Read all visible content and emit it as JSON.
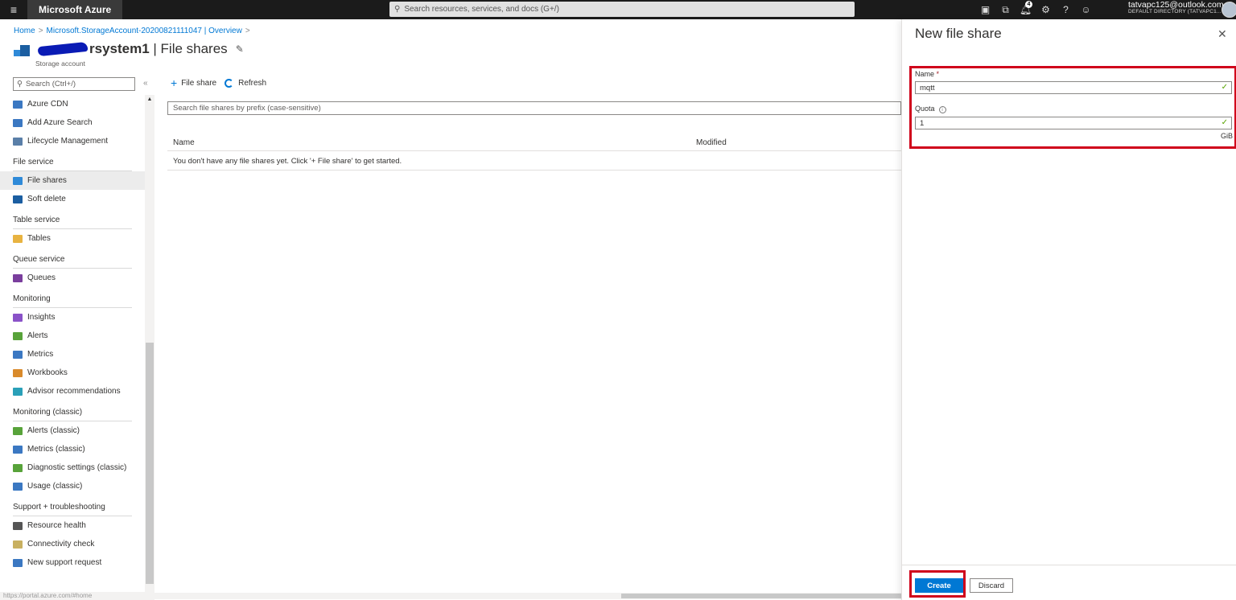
{
  "topbar": {
    "app_name": "Microsoft Azure",
    "search_placeholder": "Search resources, services, and docs (G+/)",
    "notification_count": "4",
    "account_email": "tatvapc125@outlook.com",
    "account_directory": "DEFAULT DIRECTORY (TATVAPC1...",
    "icons": [
      "cloud-shell-icon",
      "directory-filter-icon",
      "notifications-icon",
      "settings-icon",
      "help-icon",
      "feedback-icon"
    ]
  },
  "breadcrumb": [
    "Home",
    "Microsoft.StorageAccount-20200821111047 | Overview"
  ],
  "page": {
    "title_visible": "rsystem1",
    "title_suffix": " | File shares",
    "subtitle": "Storage account"
  },
  "nav": {
    "search_placeholder": "Search (Ctrl+/)",
    "collapse_glyph": "«",
    "sections": [
      {
        "header": "",
        "items": [
          {
            "label": "Azure CDN",
            "icon": "cdn-icon",
            "color": "#3b78c2"
          },
          {
            "label": "Add Azure Search",
            "icon": "search-service-icon",
            "color": "#3b78c2"
          },
          {
            "label": "Lifecycle Management",
            "icon": "lifecycle-icon",
            "color": "#5a7fa8"
          }
        ]
      },
      {
        "header": "File service",
        "items": [
          {
            "label": "File shares",
            "icon": "file-shares-icon",
            "color": "#2f8ad8",
            "active": true
          },
          {
            "label": "Soft delete",
            "icon": "soft-delete-icon",
            "color": "#1b5ea1"
          }
        ]
      },
      {
        "header": "Table service",
        "items": [
          {
            "label": "Tables",
            "icon": "tables-icon",
            "color": "#e8b341"
          }
        ]
      },
      {
        "header": "Queue service",
        "items": [
          {
            "label": "Queues",
            "icon": "queues-icon",
            "color": "#7a3e9d"
          }
        ]
      },
      {
        "header": "Monitoring",
        "items": [
          {
            "label": "Insights",
            "icon": "insights-icon",
            "color": "#8a52c8"
          },
          {
            "label": "Alerts",
            "icon": "alerts-icon",
            "color": "#58a33a"
          },
          {
            "label": "Metrics",
            "icon": "metrics-icon",
            "color": "#3b78c2"
          },
          {
            "label": "Workbooks",
            "icon": "workbooks-icon",
            "color": "#d98a2b"
          },
          {
            "label": "Advisor recommendations",
            "icon": "advisor-icon",
            "color": "#2aa0b8"
          }
        ]
      },
      {
        "header": "Monitoring (classic)",
        "items": [
          {
            "label": "Alerts (classic)",
            "icon": "alerts-classic-icon",
            "color": "#58a33a"
          },
          {
            "label": "Metrics (classic)",
            "icon": "metrics-classic-icon",
            "color": "#3b78c2"
          },
          {
            "label": "Diagnostic settings (classic)",
            "icon": "diagnostic-settings-icon",
            "color": "#58a33a"
          },
          {
            "label": "Usage (classic)",
            "icon": "usage-icon",
            "color": "#3b78c2"
          }
        ]
      },
      {
        "header": "Support + troubleshooting",
        "items": [
          {
            "label": "Resource health",
            "icon": "resource-health-icon",
            "color": "#555555"
          },
          {
            "label": "Connectivity check",
            "icon": "connectivity-check-icon",
            "color": "#c8b060"
          },
          {
            "label": "New support request",
            "icon": "support-request-icon",
            "color": "#3b78c2"
          }
        ]
      }
    ]
  },
  "toolbar": {
    "add_label": "File share",
    "refresh_label": "Refresh"
  },
  "grid": {
    "filter_placeholder": "Search file shares by prefix (case-sensitive)",
    "columns": [
      "Name",
      "Modified"
    ],
    "empty_message": "You don't have any file shares yet. Click '+ File share' to get started."
  },
  "status_url": "https://portal.azure.com/#home",
  "blade": {
    "title": "New file share",
    "name_label": "Name",
    "name_required": "*",
    "name_value": "mqtt",
    "quota_label": "Quota",
    "quota_value": "1",
    "quota_unit": "GiB",
    "create_label": "Create",
    "discard_label": "Discard",
    "highlight_color": "#d0021b"
  }
}
